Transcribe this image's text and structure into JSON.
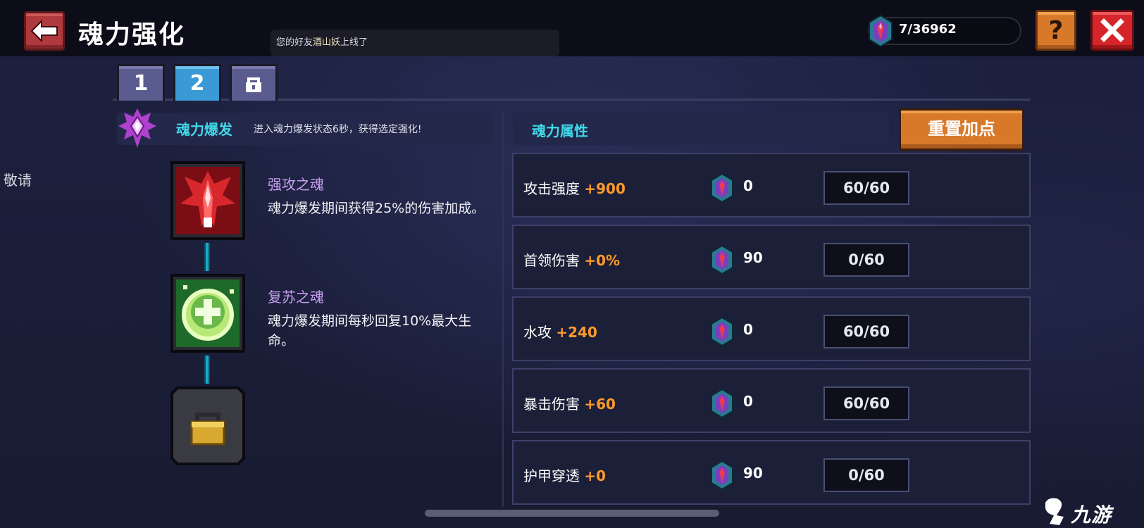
{
  "header": {
    "title": "魂力强化",
    "notice_prefix": "您的好友",
    "notice_friend": "酒山妖",
    "notice_suffix": "上线了",
    "currency": "7/36962"
  },
  "side_text": "敬请",
  "tabs": [
    {
      "label": "1"
    },
    {
      "label": "2",
      "active": true
    },
    {
      "label": "",
      "locked": true
    }
  ],
  "burst": {
    "title": "魂力爆发",
    "desc": "进入魂力爆发状态6秒，获得选定强化!"
  },
  "skills": [
    {
      "name": "强攻之魂",
      "desc": "魂力爆发期间获得25%的伤害加成。",
      "icon": "attack-soul-icon"
    },
    {
      "name": "复苏之魂",
      "desc": "魂力爆发期间每秒回复10%最大生命。",
      "icon": "revive-soul-icon"
    },
    {
      "icon": "lock-icon",
      "locked": true
    }
  ],
  "attributes": {
    "title": "魂力属性",
    "reset_label": "重置加点",
    "rows": [
      {
        "name": "攻击强度",
        "bonus": "+900",
        "cost": "0",
        "level": "60/60"
      },
      {
        "name": "首领伤害",
        "bonus": "+0%",
        "cost": "90",
        "level": "0/60"
      },
      {
        "name": "水攻",
        "bonus": "+240",
        "cost": "0",
        "level": "60/60"
      },
      {
        "name": "暴击伤害",
        "bonus": "+60",
        "cost": "0",
        "level": "60/60"
      },
      {
        "name": "护甲穿透",
        "bonus": "+0",
        "cost": "90",
        "level": "0/60"
      }
    ]
  },
  "watermark": "九游",
  "colors": {
    "accent_cyan": "#40d8e8",
    "bonus_orange": "#ff9a2a",
    "skill_name_purple": "#c8a0f0",
    "tab_active": "#3a9ad6",
    "button_orange": "#d8792a",
    "close_red": "#d6252a"
  }
}
